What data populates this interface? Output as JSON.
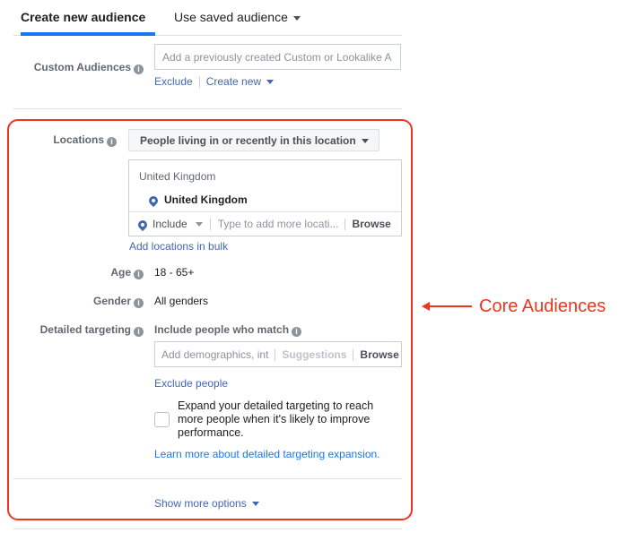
{
  "tabs": {
    "create_new": "Create new audience",
    "use_saved": "Use saved audience"
  },
  "custom_audiences": {
    "label": "Custom Audiences",
    "placeholder": "Add a previously created Custom or Lookalike A",
    "exclude": "Exclude",
    "create_new": "Create new"
  },
  "locations": {
    "label": "Locations",
    "type_select": "People living in or recently in this location",
    "group_header": "United Kingdom",
    "selected": "United Kingdom",
    "include_select": "Include",
    "search_placeholder": "Type to add more locati...",
    "browse": "Browse",
    "bulk_link": "Add locations in bulk"
  },
  "age": {
    "label": "Age",
    "value": "18 - 65+"
  },
  "gender": {
    "label": "Gender",
    "value": "All genders"
  },
  "detailed_targeting": {
    "label": "Detailed targeting",
    "include_heading": "Include people who match",
    "placeholder": "Add demographics, int",
    "suggestions": "Suggestions",
    "browse": "Browse",
    "exclude_link": "Exclude people",
    "expand_text_1": "Expand your detailed targeting to reach",
    "expand_text_2": "more people when it's likely to improve",
    "expand_text_3": "performance.",
    "expand_checked": false,
    "learn_more": "Learn more about detailed targeting expansion."
  },
  "show_more": "Show more options",
  "annotation": {
    "text": "Core Audiences",
    "color": "#f0351c"
  },
  "colors": {
    "accent": "#1877f2",
    "link": "#4267b2"
  }
}
